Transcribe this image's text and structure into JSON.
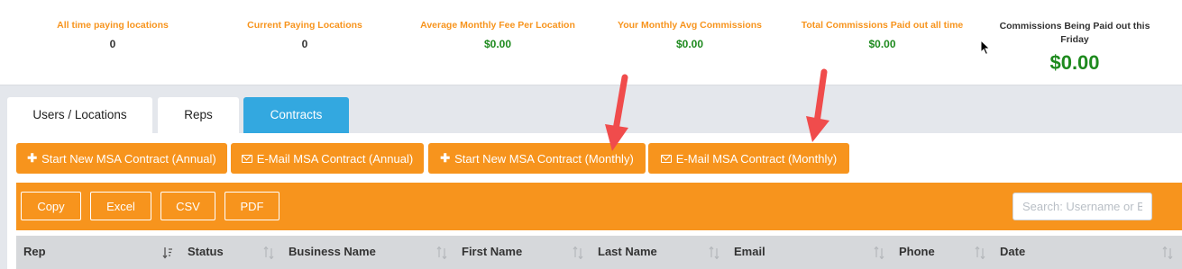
{
  "stats": [
    {
      "label": "All time paying locations",
      "value": "0",
      "kind": "count"
    },
    {
      "label": "Current Paying Locations",
      "value": "0",
      "kind": "count"
    },
    {
      "label": "Average Monthly Fee Per Location",
      "value": "$0.00",
      "kind": "money"
    },
    {
      "label": "Your Monthly Avg Commissions",
      "value": "$0.00",
      "kind": "money"
    },
    {
      "label": "Total Commissions Paid out all time",
      "value": "$0.00",
      "kind": "money"
    }
  ],
  "friday": {
    "label": "Commissions Being Paid out this Friday",
    "value": "$0.00"
  },
  "tabs": [
    {
      "label": "Users / Locations",
      "active": false
    },
    {
      "label": "Reps",
      "active": false
    },
    {
      "label": "Contracts",
      "active": true
    }
  ],
  "actions": [
    {
      "label": "Start New MSA Contract (Annual)",
      "icon": "plus-icon"
    },
    {
      "label": "E-Mail MSA Contract (Annual)",
      "icon": "envelope-icon"
    },
    {
      "label": "Start New MSA Contract (Monthly)",
      "icon": "plus-icon"
    },
    {
      "label": "E-Mail MSA Contract (Monthly)",
      "icon": "envelope-icon"
    }
  ],
  "export_buttons": [
    "Copy",
    "Excel",
    "CSV",
    "PDF"
  ],
  "search": {
    "placeholder": "Search: Username or Bu",
    "value": ""
  },
  "columns": [
    "Rep",
    "Status",
    "Business Name",
    "First Name",
    "Last Name",
    "Email",
    "Phone",
    "Date"
  ],
  "sorted_column": "Rep",
  "colors": {
    "accent": "#f7941d",
    "tab_active": "#33a8e0",
    "money": "#1e8a1e",
    "annotation_arrow": "#f04c4c"
  }
}
